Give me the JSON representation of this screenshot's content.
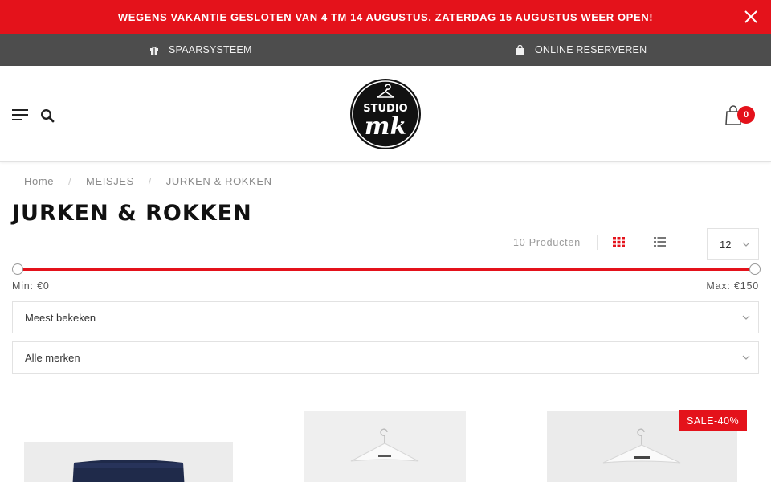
{
  "announcement": {
    "text": "WEGENS VAKANTIE GESLOTEN VAN 4 TM 14 AUGUSTUS. ZATERDAG 15 AUGUSTUS WEER OPEN!",
    "close_icon": "close-icon",
    "background": "#e4121b"
  },
  "usp": {
    "items": [
      {
        "label": "SPAARSYSTEEM",
        "icon": "gift-icon"
      },
      {
        "label": "ONLINE RESERVEREN",
        "icon": "shopping-bag-icon"
      }
    ],
    "background": "#4d4d4d"
  },
  "header": {
    "logo": {
      "top_text": "STUDIO",
      "script_text": "mk"
    },
    "menu_icon": "hamburger-menu-icon",
    "search_icon": "search-icon",
    "cart": {
      "icon": "shopping-bag-icon",
      "count": "0"
    }
  },
  "breadcrumb": [
    "Home",
    "MEISJES",
    "JURKEN & ROKKEN"
  ],
  "page": {
    "title": "JURKEN & ROKKEN",
    "product_count": "10 Producten",
    "view_icons": [
      "grid-view-icon",
      "list-view-icon"
    ],
    "per_page": "12"
  },
  "price_filter": {
    "min_label": "Min: €0",
    "max_label": "Max: €150",
    "min_value": 0,
    "max_value": 150,
    "accent": "#e4121b"
  },
  "filters": {
    "sort": "Meest bekeken",
    "brand": "Alle merken"
  },
  "products": [
    {
      "sale_badge": ""
    },
    {
      "sale_badge": ""
    },
    {
      "sale_badge": "SALE-40%"
    }
  ]
}
